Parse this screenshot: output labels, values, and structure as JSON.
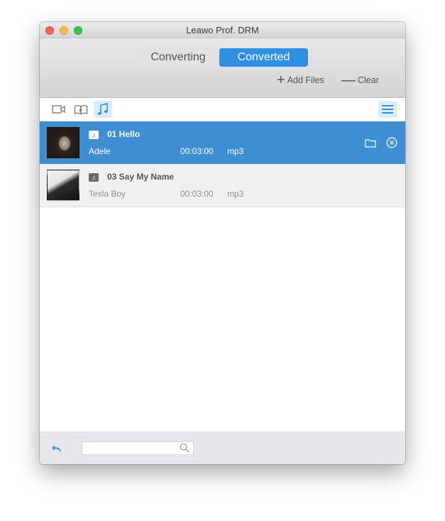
{
  "window": {
    "title": "Leawo Prof. DRM"
  },
  "tabs": [
    {
      "label": "Converting",
      "active": false
    },
    {
      "label": "Converted",
      "active": true
    }
  ],
  "toolbar": {
    "add_files_label": "Add Files",
    "clear_label": "Clear"
  },
  "filters": {
    "items": [
      {
        "name": "video-filter",
        "icon": "video-camera-icon",
        "active": false
      },
      {
        "name": "ebook-filter",
        "icon": "book-icon",
        "active": false
      },
      {
        "name": "music-filter",
        "icon": "music-note-icon",
        "active": true
      }
    ],
    "view_toggle_icon": "list-view-icon"
  },
  "tracks": [
    {
      "title": "01 Hello",
      "artist": "Adele",
      "duration": "00:03:00",
      "format": "mp3",
      "selected": true
    },
    {
      "title": "03 Say My Name",
      "artist": "Tesla Boy",
      "duration": "00:03:00",
      "format": "mp3",
      "selected": false
    }
  ],
  "search": {
    "value": "",
    "placeholder": ""
  },
  "colors": {
    "accent": "#2f8fe3",
    "selected_row": "#3d8fd1",
    "icon_highlight": "#d9ecfb"
  }
}
